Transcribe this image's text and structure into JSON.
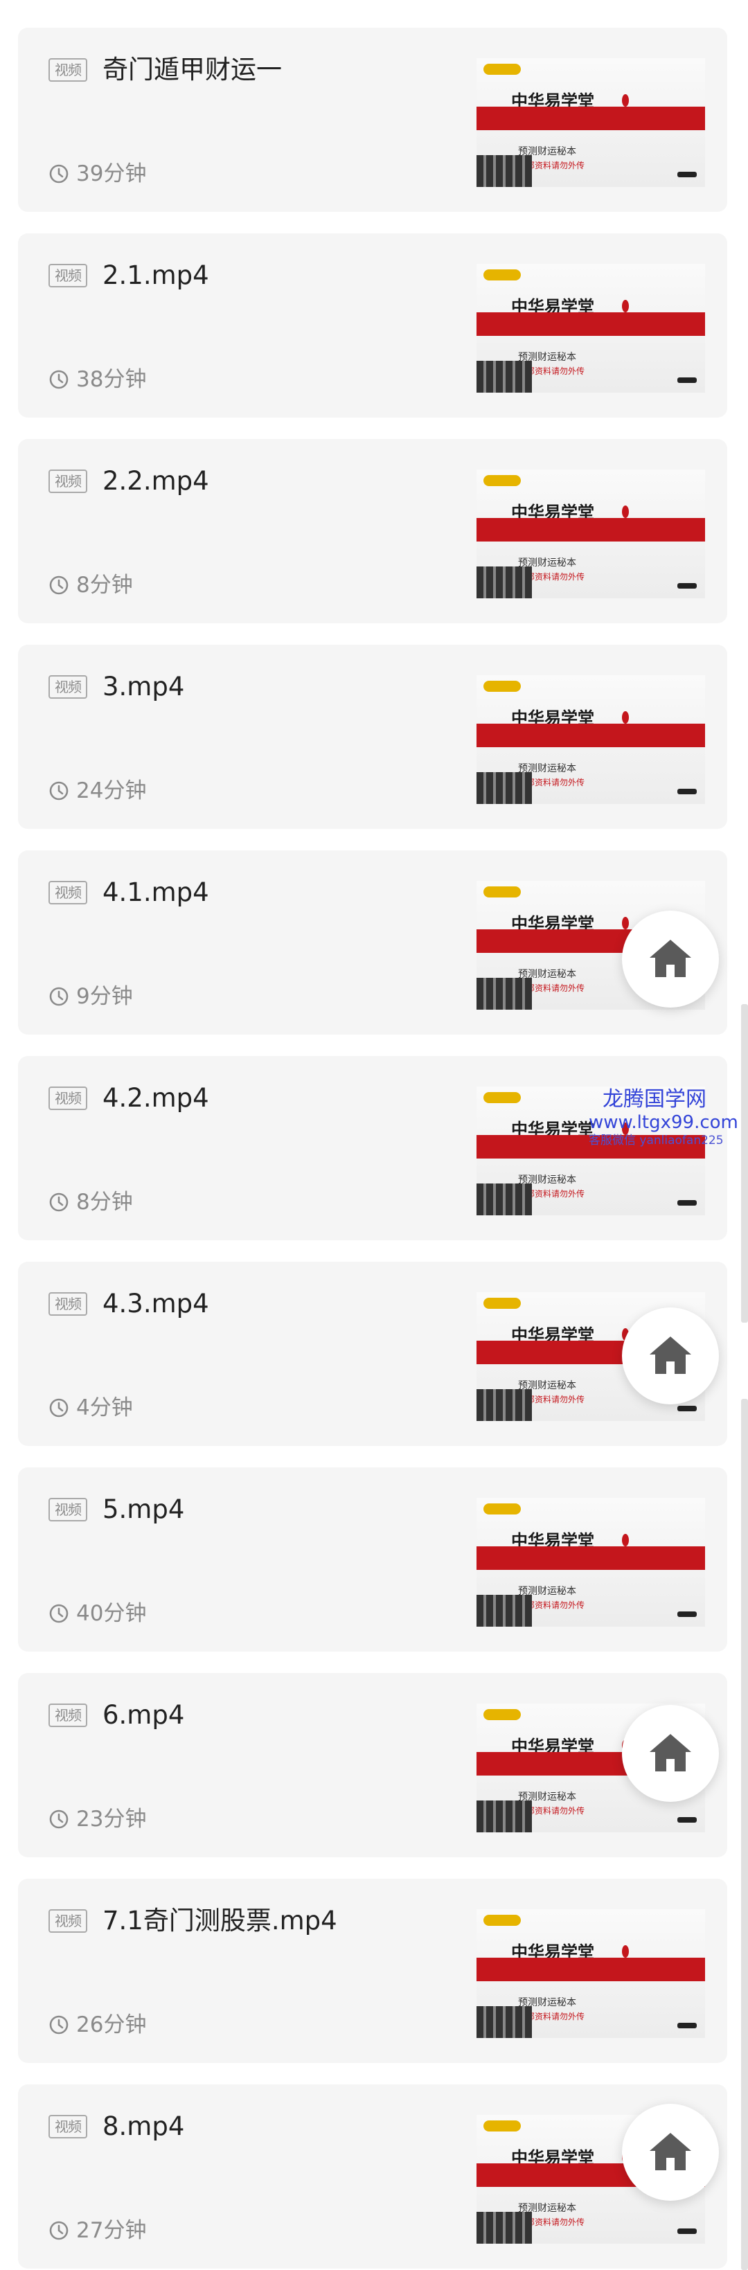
{
  "tag_label": "视频",
  "items": [
    {
      "title": "奇门遁甲财运一",
      "duration": "39分钟"
    },
    {
      "title": "2.1.mp4",
      "duration": "38分钟"
    },
    {
      "title": "2.2.mp4",
      "duration": "8分钟"
    },
    {
      "title": "3.mp4",
      "duration": "24分钟"
    },
    {
      "title": "4.1.mp4",
      "duration": "9分钟"
    },
    {
      "title": "4.2.mp4",
      "duration": "8分钟"
    },
    {
      "title": "4.3.mp4",
      "duration": "4分钟"
    },
    {
      "title": "5.mp4",
      "duration": "40分钟"
    },
    {
      "title": "6.mp4",
      "duration": "23分钟"
    },
    {
      "title": "7.1奇门测股票.mp4",
      "duration": "26分钟"
    },
    {
      "title": "8.mp4",
      "duration": "27分钟"
    }
  ],
  "thumbnail": {
    "name": "中华易学堂",
    "subtitle": "预测财运秘本",
    "caption": "内部资料请勿外传"
  },
  "watermark": {
    "line1": "龙腾国学网",
    "line2": "www.ltgx99.com",
    "line3": "客服微信 yanliaofan225"
  },
  "icons": {
    "duration": "clock-icon",
    "home": "home-icon"
  },
  "colors": {
    "card_bg": "#f5f5f5",
    "accent_red": "#c4161c",
    "watermark": "#3344d8"
  }
}
